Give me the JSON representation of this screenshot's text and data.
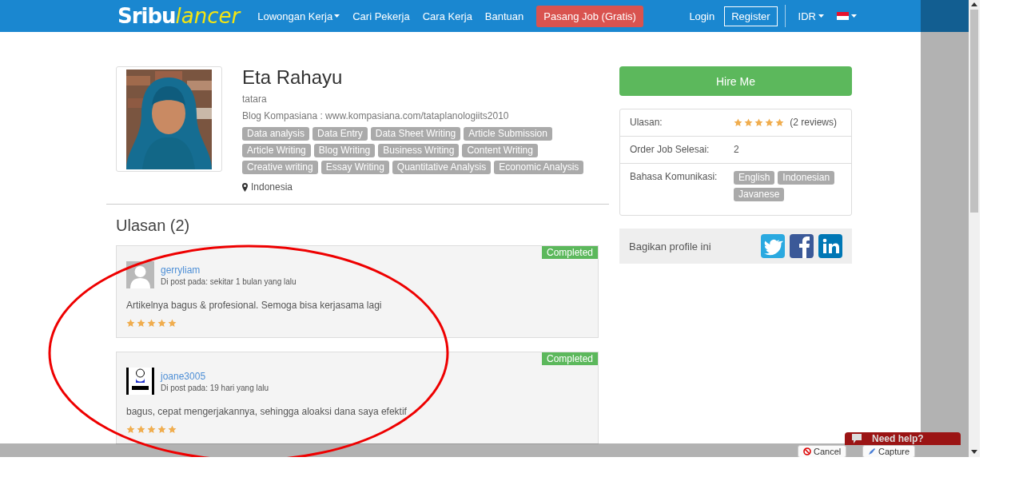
{
  "navbar": {
    "logo_primary": "Sribu",
    "logo_secondary": "lancer",
    "links": [
      {
        "label": "Lowongan Kerja",
        "dropdown": true
      },
      {
        "label": "Cari Pekerja",
        "dropdown": false
      },
      {
        "label": "Cara Kerja",
        "dropdown": false
      },
      {
        "label": "Bantuan",
        "dropdown": false
      }
    ],
    "post_job_button": "Pasang Job (Gratis)",
    "login": "Login",
    "register": "Register",
    "currency": "IDR"
  },
  "profile": {
    "name": "Eta Rahayu",
    "username": "tatara",
    "bio": "Blog Kompasiana : www.kompasiana.com/tataplanologiits2010",
    "skills": [
      "Data analysis",
      "Data Entry",
      "Data Sheet Writing",
      "Article Submission",
      "Article Writing",
      "Blog Writing",
      "Business Writing",
      "Content Writing",
      "Creative writing",
      "Essay Writing",
      "Quantitative Analysis",
      "Economic Analysis"
    ],
    "location": "Indonesia"
  },
  "reviews_section": {
    "title": "Ulasan (2)",
    "reviews": [
      {
        "user": "gerryliam",
        "posted": "Di post pada: sekitar 1 bulan yang lalu",
        "comment": "Artikelnya bagus & profesional. Semoga bisa kerjasama lagi",
        "stars": 5,
        "status": "Completed"
      },
      {
        "user": "joane3005",
        "posted": "Di post pada: 19 hari yang lalu",
        "comment": "bagus, cepat mengerjakannya, sehingga aloaksi dana saya efektif",
        "stars": 5,
        "status": "Completed"
      }
    ]
  },
  "sidebar": {
    "hire_button": "Hire Me",
    "rating": {
      "label": "Ulasan:",
      "stars": 5,
      "count": "(2 reviews)"
    },
    "orders": {
      "label": "Order Job Selesai:",
      "value": "2"
    },
    "languages": {
      "label": "Bahasa Komunikasi:",
      "items": [
        "English",
        "Indonesian",
        "Javanese"
      ]
    },
    "share": {
      "label": "Bagikan profile ini"
    }
  },
  "help_widget": {
    "label": "Need help?"
  },
  "capture_toolbar": {
    "cancel": "Cancel",
    "capture": "Capture"
  }
}
